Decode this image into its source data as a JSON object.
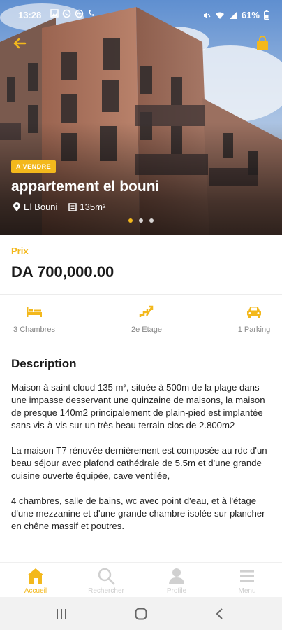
{
  "status": {
    "time": "13:28",
    "battery": "61%",
    "left_icons": [
      "image-icon",
      "whatsapp-icon",
      "messenger-icon",
      "phone-icon"
    ],
    "right_icons": [
      "mute-icon",
      "wifi-icon",
      "signal-icon"
    ]
  },
  "hero": {
    "badge": "A VENDRE",
    "title": "appartement el bouni",
    "location": "El Bouni",
    "area": "135m²",
    "slides": 3,
    "active_slide": 1
  },
  "price": {
    "label": "Prix",
    "value": "DA 700,000.00"
  },
  "features": [
    {
      "icon": "bed-icon",
      "label": "3 Chambres"
    },
    {
      "icon": "stairs-icon",
      "label": "2e Etage"
    },
    {
      "icon": "car-icon",
      "label": "1 Parking"
    }
  ],
  "description": {
    "title": "Description",
    "paragraphs": [
      "Maison à saint cloud 135 m², située à 500m de la plage dans une impasse desservant une quinzaine de maisons, la maison de presque 140m2 principalement de plain-pied est implantée sans vis-à-vis sur un très beau terrain clos de 2.800m2",
      "La maison T7 rénovée dernièrement est composée au rdc d'un beau séjour avec plafond cathédrale de 5.5m et d'une grande cuisine ouverte équipée, cave ventilée,",
      "4 chambres, salle de bains, wc avec point d'eau, et à l'étage d'une mezzanine et d'une grande chambre isolée sur plancher en chêne massif et poutres."
    ]
  },
  "bottom_nav": [
    {
      "icon": "home-icon",
      "label": "Accueil",
      "active": true
    },
    {
      "icon": "search-icon",
      "label": "Rechercher",
      "active": false
    },
    {
      "icon": "profile-icon",
      "label": "Profile",
      "active": false
    },
    {
      "icon": "menu-icon",
      "label": "Menu",
      "active": false
    }
  ],
  "colors": {
    "accent": "#f3b81c",
    "text": "#1a1a1a",
    "muted": "#888888"
  }
}
